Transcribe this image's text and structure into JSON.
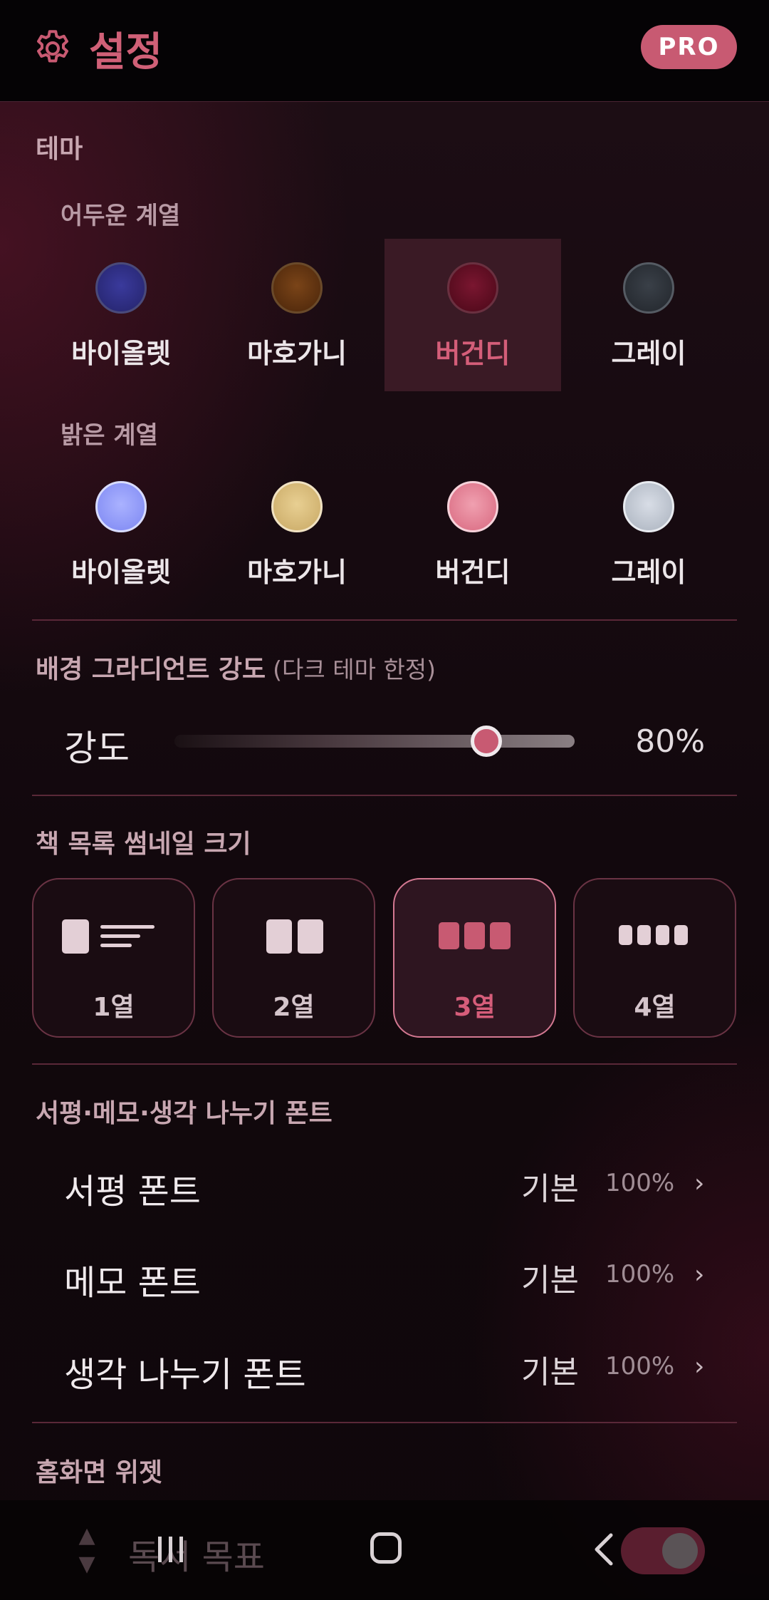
{
  "header": {
    "title": "설정",
    "badge": "PRO"
  },
  "theme": {
    "section_title": "테마",
    "dark_group": {
      "label": "어두운 계열",
      "items": [
        {
          "label": "바이올렛",
          "color": "#2c2a78"
        },
        {
          "label": "마호가니",
          "color": "#6a3612"
        },
        {
          "label": "버건디",
          "color": "#6a1028",
          "selected": true
        },
        {
          "label": "그레이",
          "color": "#2c3138"
        }
      ]
    },
    "light_group": {
      "label": "밝은 계열",
      "items": [
        {
          "label": "바이올렛",
          "color": "#8c96ff"
        },
        {
          "label": "마호가니",
          "color": "#d8bc7c"
        },
        {
          "label": "버건디",
          "color": "#e27a92"
        },
        {
          "label": "그레이",
          "color": "#bcc4d0"
        }
      ]
    }
  },
  "gradient": {
    "section_title": "배경 그라디언트 강도",
    "note": "(다크 테마 한정)",
    "slider_label": "강도",
    "value_text": "80%",
    "value": 0.78
  },
  "thumbnail": {
    "section_title": "책 목록 썸네일 크기",
    "options": [
      {
        "label": "1열"
      },
      {
        "label": "2열"
      },
      {
        "label": "3열",
        "selected": true
      },
      {
        "label": "4열"
      }
    ]
  },
  "fonts": {
    "section_title": "서평·메모·생각 나누기 폰트",
    "rows": [
      {
        "label": "서평 폰트",
        "value": "기본",
        "percent": "100%"
      },
      {
        "label": "메모 폰트",
        "value": "기본",
        "percent": "100%"
      },
      {
        "label": "생각 나누기 폰트",
        "value": "기본",
        "percent": "100%"
      }
    ]
  },
  "widget": {
    "section_title": "홈화면 위젯",
    "row_label": "독서 목표",
    "enabled": true
  },
  "accent_color": "#c85a72"
}
